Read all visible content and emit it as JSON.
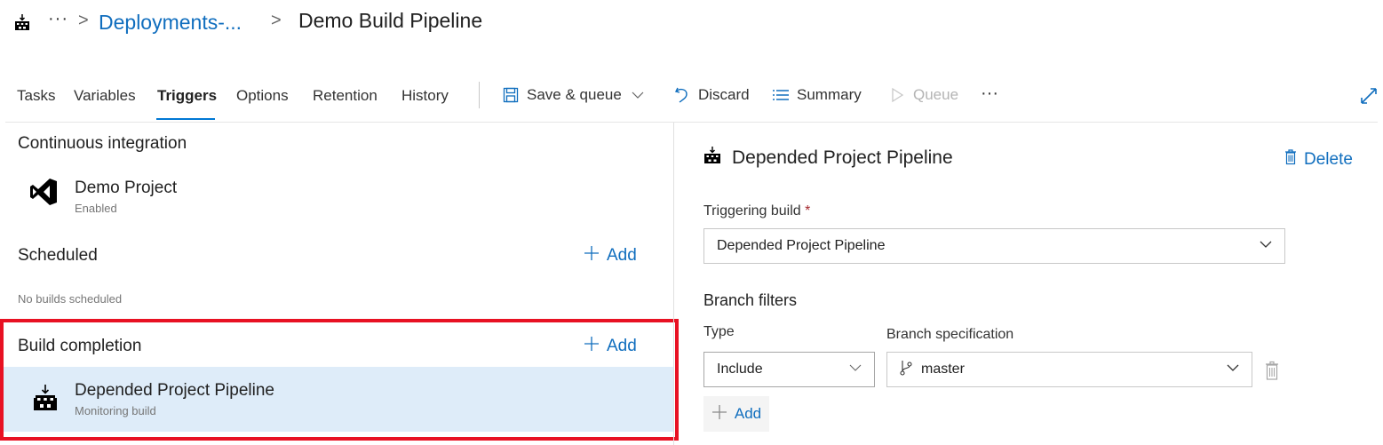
{
  "breadcrumb": {
    "icon": "build-pipeline-icon",
    "ellipsis": "···",
    "separator": ">",
    "parent": "Deployments-...",
    "title": "Demo Build Pipeline"
  },
  "tabs": [
    {
      "label": "Tasks",
      "active": false
    },
    {
      "label": "Variables",
      "active": false
    },
    {
      "label": "Triggers",
      "active": true
    },
    {
      "label": "Options",
      "active": false
    },
    {
      "label": "Retention",
      "active": false
    },
    {
      "label": "History",
      "active": false
    }
  ],
  "toolbar": {
    "save_queue": "Save & queue",
    "discard": "Discard",
    "summary": "Summary",
    "queue": "Queue",
    "more": "···"
  },
  "left_panel": {
    "ci": {
      "title": "Continuous integration",
      "item": {
        "name": "Demo Project",
        "status": "Enabled",
        "icon": "visual-studio-icon"
      }
    },
    "scheduled": {
      "title": "Scheduled",
      "add_label": "Add",
      "empty_text": "No builds scheduled"
    },
    "build_completion": {
      "title": "Build completion",
      "add_label": "Add",
      "item": {
        "name": "Depended Project Pipeline",
        "status": "Monitoring build",
        "icon": "build-pipeline-icon"
      }
    }
  },
  "right_panel": {
    "title": "Depended Project Pipeline",
    "delete_label": "Delete",
    "triggering_build": {
      "label": "Triggering build",
      "required_mark": "*",
      "value": "Depended Project Pipeline"
    },
    "branch_filters": {
      "title": "Branch filters",
      "type_label": "Type",
      "spec_label": "Branch specification",
      "type_value": "Include",
      "spec_value": "master",
      "add_label": "Add"
    }
  },
  "colors": {
    "accent": "#0078d4",
    "link": "#106ebe",
    "selected_row": "#deecf9",
    "highlight_border": "#e81123"
  }
}
